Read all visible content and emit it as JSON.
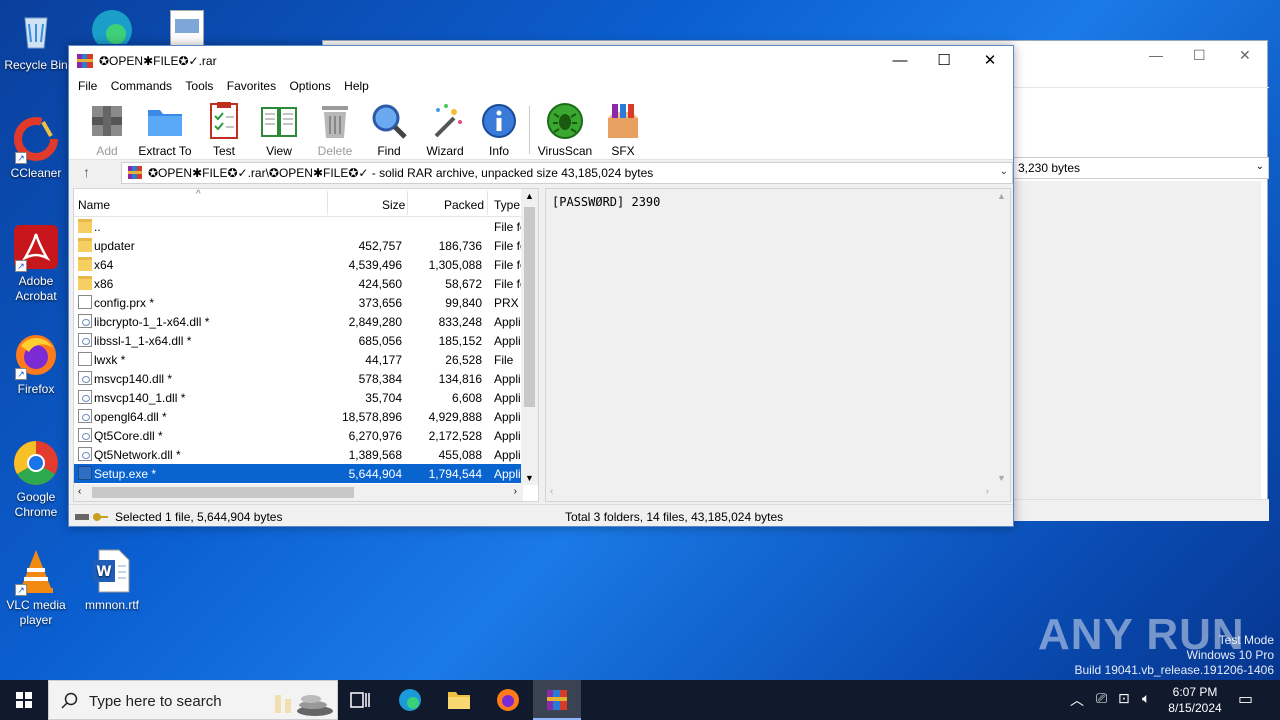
{
  "desktop": {
    "icons": [
      {
        "label": "Recycle Bin",
        "icon": "recycle-bin-icon"
      },
      {
        "label": "CCleaner",
        "icon": "ccleaner-icon"
      },
      {
        "label": "Adobe Acrobat",
        "icon": "acrobat-icon"
      },
      {
        "label": "Firefox",
        "icon": "firefox-icon"
      },
      {
        "label": "Google Chrome",
        "icon": "chrome-icon"
      },
      {
        "label": "VLC media player",
        "icon": "vlc-icon"
      },
      {
        "label": "mmnon.rtf",
        "icon": "word-doc-icon"
      }
    ]
  },
  "bg_window": {
    "address_text": "3,230 bytes"
  },
  "window": {
    "title": "✪OPEN✱FILE✪✓.rar",
    "controls": {
      "minimize": "—",
      "maximize": "☐",
      "close": "✕"
    }
  },
  "menu": [
    "File",
    "Commands",
    "Tools",
    "Favorites",
    "Options",
    "Help"
  ],
  "toolbar": {
    "add": "Add",
    "extract": "Extract To",
    "test": "Test",
    "view": "View",
    "delete": "Delete",
    "find": "Find",
    "wizard": "Wizard",
    "info": "Info",
    "virusscan": "VirusScan",
    "sfx": "SFX"
  },
  "path": {
    "text": "✪OPEN✱FILE✪✓.rar\\✪OPEN✱FILE✪✓ - solid RAR archive, unpacked size 43,185,024 bytes"
  },
  "filelist": {
    "columns": {
      "name": "Name",
      "size": "Size",
      "packed": "Packed",
      "type": "Type"
    },
    "rows": [
      {
        "name": "..",
        "size": "",
        "packed": "",
        "type": "File fo",
        "kind": "folder"
      },
      {
        "name": "updater",
        "size": "452,757",
        "packed": "186,736",
        "type": "File fo",
        "kind": "folder"
      },
      {
        "name": "x64",
        "size": "4,539,496",
        "packed": "1,305,088",
        "type": "File fo",
        "kind": "folder"
      },
      {
        "name": "x86",
        "size": "424,560",
        "packed": "58,672",
        "type": "File fo",
        "kind": "folder"
      },
      {
        "name": "config.prx *",
        "size": "373,656",
        "packed": "99,840",
        "type": "PRX F",
        "kind": "file"
      },
      {
        "name": "libcrypto-1_1-x64.dll *",
        "size": "2,849,280",
        "packed": "833,248",
        "type": "Appli",
        "kind": "dll"
      },
      {
        "name": "libssl-1_1-x64.dll *",
        "size": "685,056",
        "packed": "185,152",
        "type": "Appli",
        "kind": "dll"
      },
      {
        "name": "lwxk *",
        "size": "44,177",
        "packed": "26,528",
        "type": "File",
        "kind": "file"
      },
      {
        "name": "msvcp140.dll *",
        "size": "578,384",
        "packed": "134,816",
        "type": "Appli",
        "kind": "dll"
      },
      {
        "name": "msvcp140_1.dll *",
        "size": "35,704",
        "packed": "6,608",
        "type": "Appli",
        "kind": "dll"
      },
      {
        "name": "opengl64.dll *",
        "size": "18,578,896",
        "packed": "4,929,888",
        "type": "Appli",
        "kind": "dll"
      },
      {
        "name": "Qt5Core.dll *",
        "size": "6,270,976",
        "packed": "2,172,528",
        "type": "Appli",
        "kind": "dll"
      },
      {
        "name": "Qt5Network.dll *",
        "size": "1,389,568",
        "packed": "455,088",
        "type": "Appli",
        "kind": "dll"
      },
      {
        "name": "Setup.exe *",
        "size": "5,644,904",
        "packed": "1,794,544",
        "type": "Appli",
        "kind": "exe",
        "selected": true
      }
    ]
  },
  "comment": {
    "text": "[PASSWØRD] 2390"
  },
  "status": {
    "left": "Selected 1 file, 5,644,904 bytes",
    "right": "Total 3 folders, 14 files, 43,185,024 bytes"
  },
  "watermark": {
    "brand": "ANY RUN",
    "line1": "Test Mode",
    "line2": "Windows 10 Pro",
    "line3": "Build 19041.vb_release.191206-1406"
  },
  "taskbar": {
    "search_placeholder": "Type here to search",
    "time": "6:07 PM",
    "date": "8/15/2024"
  },
  "colors": {
    "selection": "#0a64d0",
    "taskbar": "#101a2c",
    "desktop": "#0b5fd0"
  }
}
